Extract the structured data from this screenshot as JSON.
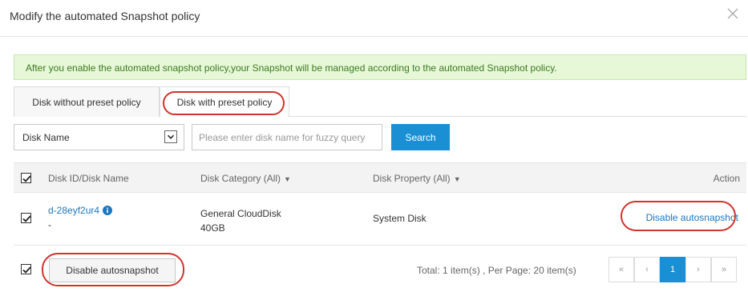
{
  "dialog": {
    "title": "Modify the automated Snapshot policy",
    "close_icon": "close-icon"
  },
  "alert": {
    "text": "After you enable the automated snapshot policy,your Snapshot will be managed according to the automated Snapshot policy."
  },
  "tabs": [
    {
      "label": "Disk without preset policy",
      "active": false
    },
    {
      "label": "Disk with preset policy",
      "active": true
    }
  ],
  "filter": {
    "select_value": "Disk Name",
    "search_placeholder": "Please enter disk name for fuzzy query",
    "search_label": "Search"
  },
  "table": {
    "headers": {
      "id": "Disk ID/Disk Name",
      "category": "Disk Category (All)",
      "property": "Disk Property (All)",
      "action": "Action"
    },
    "rows": [
      {
        "disk_id": "d-28eyf2ur4",
        "disk_name": "-",
        "category": "General CloudDisk",
        "size": "40GB",
        "property": "System Disk",
        "action": "Disable autosnapshot",
        "checked": true
      }
    ]
  },
  "footer": {
    "bulk_action": "Disable autosnapshot",
    "total_text": "Total: 1 item(s) ,  Per Page: 20 item(s)",
    "pagination": {
      "first": "«",
      "prev": "‹",
      "current": "1",
      "next": "›",
      "last": "»"
    }
  },
  "colors": {
    "primary": "#1a8fd3",
    "annotation": "#d0342c",
    "alert_bg": "#e6f8d8",
    "alert_text": "#3c7a1e"
  }
}
